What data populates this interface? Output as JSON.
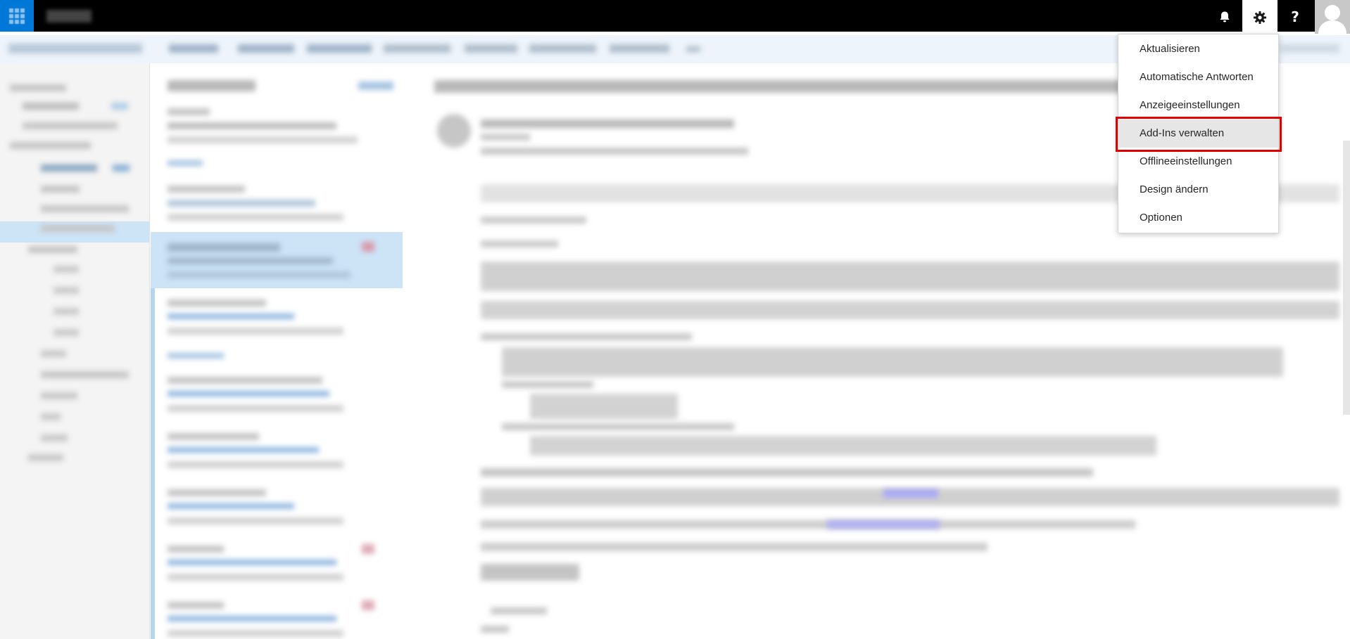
{
  "topbar": {
    "waffle_icon": "waffle-icon",
    "notifications_icon": "bell-icon",
    "settings_icon": "gear-icon",
    "help_label": "?",
    "avatar_icon": "person-icon"
  },
  "settings_menu": {
    "items": [
      {
        "label": "Aktualisieren"
      },
      {
        "label": "Automatische Antworten"
      },
      {
        "label": "Anzeigeeinstellungen"
      },
      {
        "label": "Add-Ins verwalten",
        "highlighted": true
      },
      {
        "label": "Offlineeinstellungen"
      },
      {
        "label": "Design ändern"
      },
      {
        "label": "Optionen"
      }
    ]
  },
  "colors": {
    "topbar": "#000000",
    "brand": "#0078d7",
    "selection": "#cde4f7",
    "highlight_border": "#e00000"
  }
}
